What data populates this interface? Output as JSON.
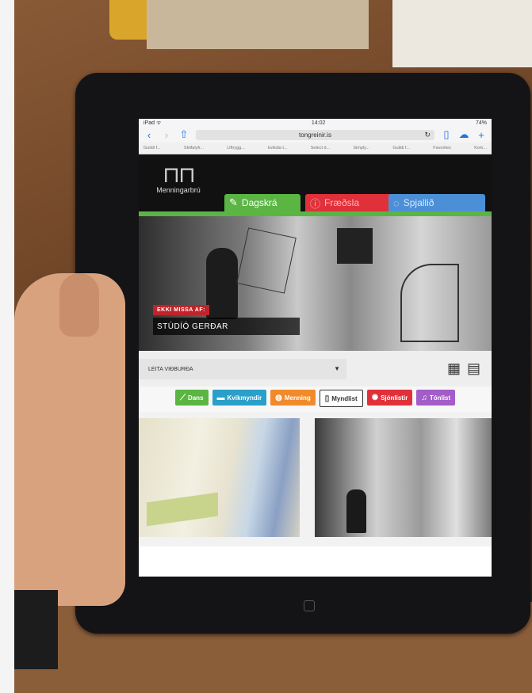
{
  "device": {
    "status_left": "iPad ᯤ",
    "time": "14:02",
    "battery": "74%"
  },
  "browser": {
    "url": "tongreinir.is",
    "favorites": [
      "Guildi f...",
      "Skilfalyfr...",
      "Liftrygg...",
      "kvikida t...",
      "Select d...",
      "Simply...",
      "Guildi f...",
      "Favorites",
      "Kom..."
    ]
  },
  "site": {
    "logo_text": "Menningarbrú",
    "tabs": [
      {
        "label": "Dagskrá"
      },
      {
        "label": "Fræðsla"
      },
      {
        "label": "Spjallið"
      }
    ],
    "hero": {
      "badge": "EKKI MISSA AF:",
      "caption": "STÚDÍÓ GERÐAR"
    },
    "search": {
      "label": "LEITA VIÐBURÐA"
    },
    "categories": [
      {
        "label": "Dans"
      },
      {
        "label": "Kvikmyndir"
      },
      {
        "label": "Menning"
      },
      {
        "label": "Myndlist"
      },
      {
        "label": "Sjónlistir"
      },
      {
        "label": "Tónlist"
      }
    ]
  },
  "colors": {
    "green": "#5ab543",
    "red": "#e0313a",
    "blue": "#4b90d6",
    "purple": "#a35cc8",
    "orange": "#f08a2a",
    "teal": "#2aa0c8"
  },
  "icons": [
    "back-icon",
    "forward-icon",
    "share-icon",
    "reload-icon",
    "bookmarks-icon",
    "cloud-icon",
    "new-tab-icon",
    "pencil-icon",
    "info-icon",
    "chat-icon",
    "dropdown-arrow-icon",
    "grid-view-icon",
    "calendar-view-icon"
  ]
}
